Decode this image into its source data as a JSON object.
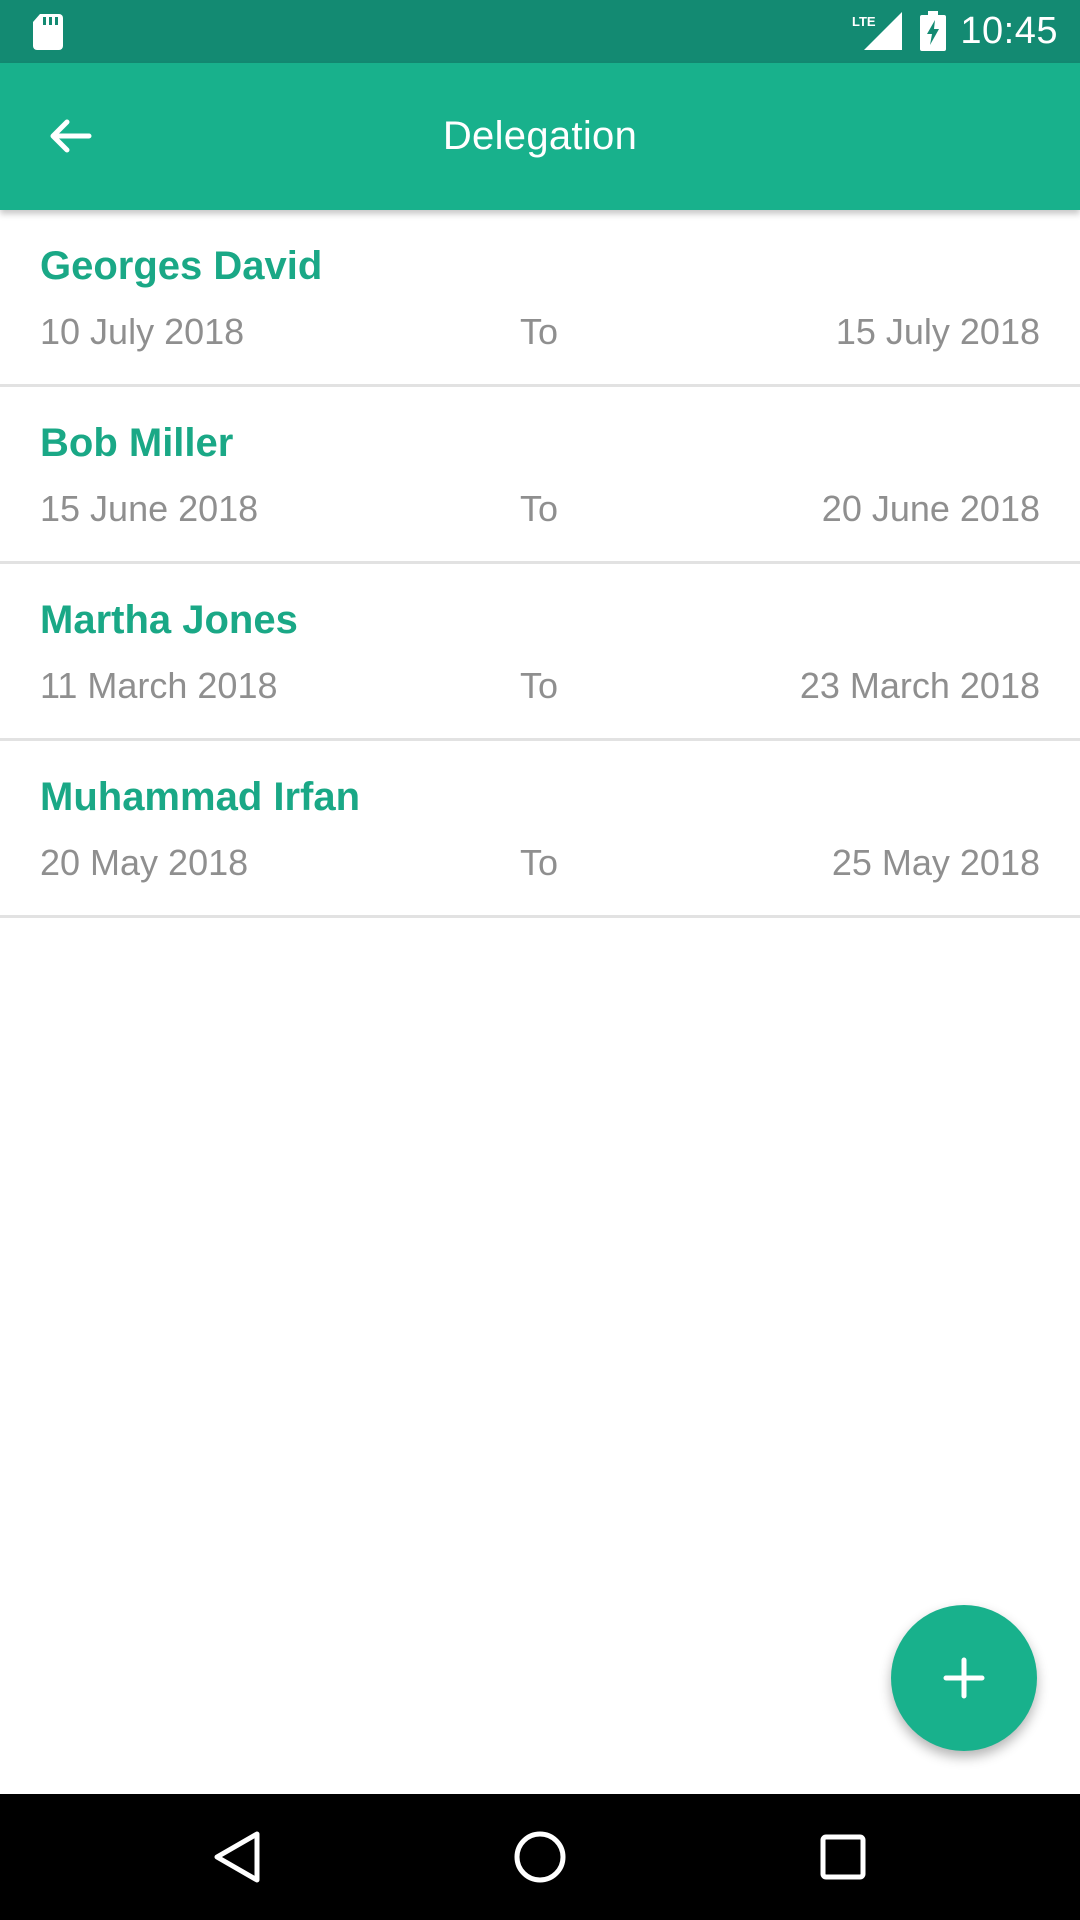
{
  "status_bar": {
    "time": "10:45",
    "network_label": "LTE",
    "icons": [
      "sd-card-icon",
      "lte-signal-icon",
      "battery-charging-icon"
    ]
  },
  "app_bar": {
    "title": "Delegation",
    "back_icon": "arrow-back-icon"
  },
  "delegations": [
    {
      "name": "Georges David",
      "from": "10 July 2018",
      "to_label": "To",
      "to": "15 July 2018"
    },
    {
      "name": "Bob Miller",
      "from": "15 June 2018",
      "to_label": "To",
      "to": "20 June 2018"
    },
    {
      "name": "Martha Jones",
      "from": "11 March 2018",
      "to_label": "To",
      "to": "23 March 2018"
    },
    {
      "name": "Muhammad Irfan",
      "from": "20 May 2018",
      "to_label": "To",
      "to": "25 May 2018"
    }
  ],
  "fab": {
    "icon": "plus-icon"
  },
  "nav_bar": {
    "icons": [
      "nav-back-icon",
      "nav-home-icon",
      "nav-recents-icon"
    ]
  },
  "colors": {
    "status_bar": "#138a72",
    "primary": "#18b18c",
    "name_text": "#1aa886",
    "secondary_text": "#8f8f8f",
    "divider": "#e2e2e2"
  }
}
